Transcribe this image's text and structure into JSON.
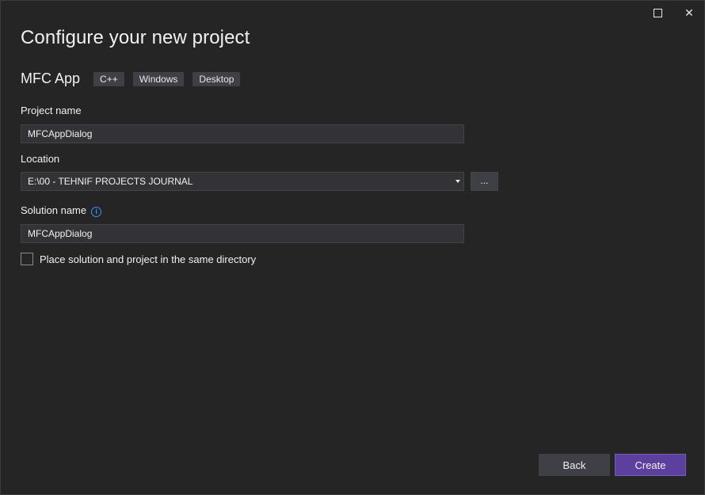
{
  "window": {
    "maximize_icon": "maximize-icon",
    "close_icon": "close-icon"
  },
  "header": {
    "title": "Configure your new project"
  },
  "template": {
    "name": "MFC App",
    "tags": [
      "C++",
      "Windows",
      "Desktop"
    ]
  },
  "form": {
    "project_name_label": "Project name",
    "project_name_value": "MFCAppDialog",
    "location_label": "Location",
    "location_value": "E:\\00 - TEHNIF PROJECTS JOURNAL",
    "browse_label": "...",
    "solution_name_label": "Solution name",
    "solution_name_value": "MFCAppDialog",
    "same_directory_label": "Place solution and project in the same directory",
    "same_directory_checked": false
  },
  "footer": {
    "back_label": "Back",
    "create_label": "Create"
  },
  "colors": {
    "background": "#252526",
    "accent": "#5d3f9e",
    "info": "#3794ff"
  }
}
